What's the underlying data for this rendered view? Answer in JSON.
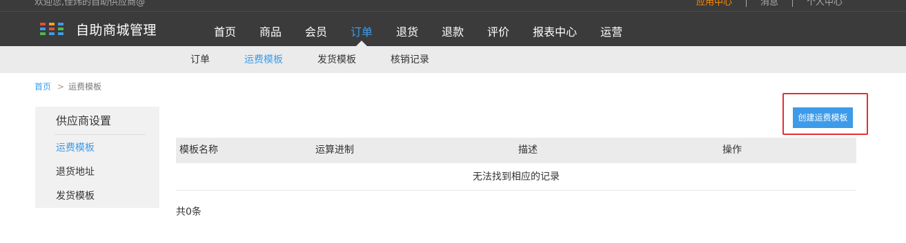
{
  "header": {
    "welcome": "欢迎您,佳炜的自助供应商@",
    "top_links": [
      {
        "label": "应用中心",
        "accent": true
      },
      {
        "label": "消息",
        "accent": false
      },
      {
        "label": "个人中心",
        "accent": false
      }
    ],
    "brand": "自助商城管理",
    "logo_icon": "grid-dots-icon",
    "nav": [
      {
        "label": "首页"
      },
      {
        "label": "商品"
      },
      {
        "label": "会员"
      },
      {
        "label": "订单",
        "active": true
      },
      {
        "label": "退货"
      },
      {
        "label": "退款"
      },
      {
        "label": "评价"
      },
      {
        "label": "报表中心"
      },
      {
        "label": "运营"
      }
    ]
  },
  "subnav": [
    {
      "label": "订单"
    },
    {
      "label": "运费模板",
      "active": true
    },
    {
      "label": "发货模板"
    },
    {
      "label": "核销记录"
    }
  ],
  "breadcrumb": {
    "home": "首页",
    "separator": ">",
    "current": "运费模板"
  },
  "sidebar": {
    "title": "供应商设置",
    "items": [
      {
        "label": "运费模板",
        "active": true
      },
      {
        "label": "退货地址"
      },
      {
        "label": "发货模板"
      }
    ]
  },
  "main": {
    "create_button": "创建运费模板",
    "table": {
      "columns": [
        "模板名称",
        "运算进制",
        "描述",
        "操作"
      ],
      "empty_text": "无法找到相应的记录"
    },
    "count_text": "共0条"
  },
  "colors": {
    "header_bg": "#3b3b3b",
    "accent_blue": "#3d9be9",
    "accent_orange": "#ff8a00",
    "highlight_red": "#e52e2e"
  }
}
